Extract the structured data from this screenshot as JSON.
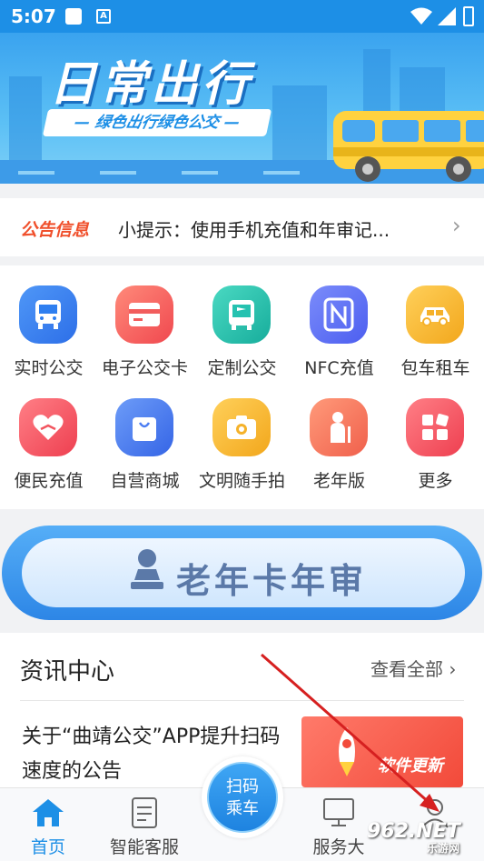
{
  "status_bar": {
    "time": "5:07",
    "notif_icon": "a-icon"
  },
  "banner": {
    "title": "日常出行",
    "subtitle": "— 绿色出行绿色公交 —"
  },
  "notice": {
    "tag": "公告信息",
    "text": "小提示：使用手机充值和年审记..."
  },
  "services": [
    {
      "label": "实时公交",
      "icon": "bus-icon",
      "color": "#2f7ff0"
    },
    {
      "label": "电子公交卡",
      "icon": "card-icon",
      "color": "#f25d5d"
    },
    {
      "label": "定制公交",
      "icon": "custom-bus-icon",
      "color": "#25c2b0"
    },
    {
      "label": "NFC充值",
      "icon": "nfc-icon",
      "color": "#5b6ef5"
    },
    {
      "label": "包车租车",
      "icon": "car-icon",
      "color": "#f5b12a"
    },
    {
      "label": "便民充值",
      "icon": "heart-hand-icon",
      "color": "#f2555f"
    },
    {
      "label": "自营商城",
      "icon": "shopping-bag-icon",
      "color": "#4a7cf2"
    },
    {
      "label": "文明随手拍",
      "icon": "camera-icon",
      "color": "#f5b22a"
    },
    {
      "label": "老年版",
      "icon": "elderly-icon",
      "color": "#f57560"
    },
    {
      "label": "更多",
      "icon": "more-icon",
      "color": "#f2555f"
    }
  ],
  "annual_banner": {
    "text": "老年卡年审"
  },
  "news": {
    "heading": "资讯中心",
    "view_all": "查看全部",
    "article_title": "关于“曲靖公交”APP提升扫码速度的公告",
    "thumb_text": "软件更新"
  },
  "tabbar": {
    "home": "首页",
    "service": "智能客服",
    "scan": "扫码\n乘车",
    "hall": "服务大",
    "mine": ""
  },
  "watermark": {
    "main": "962.NET",
    "sub": "乐游网"
  }
}
